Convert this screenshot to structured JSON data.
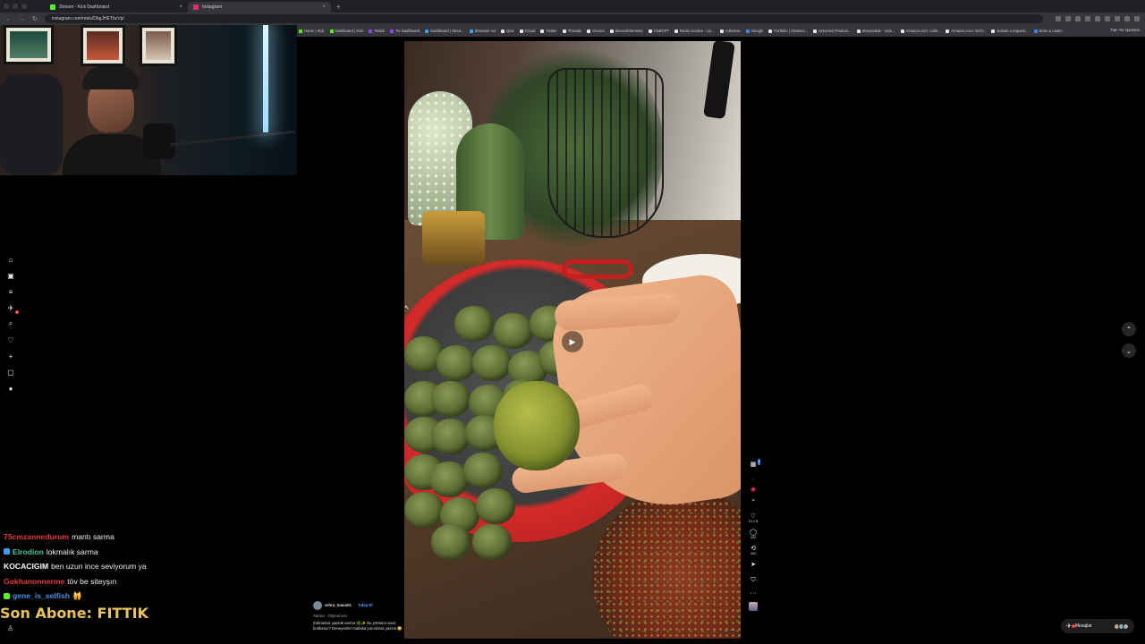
{
  "browser": {
    "tabs": [
      {
        "label": "Stream - Kick Dashboard",
        "color": "#53fc18",
        "active": false
      },
      {
        "label": "Instagram",
        "color": "#e1306c",
        "active": true
      }
    ],
    "url": "instagram.com/reels/DbgJHETbcVp/",
    "bookmarks": [
      "Home | Kick",
      "Dashboard | Kick",
      "Twitch",
      "Tw Dashboard",
      "Dashboard | Strea...",
      "Streamer Ad",
      "Qovi",
      "iCloud",
      "Twitter",
      "Threads",
      "Ozurus",
      "StreamElements",
      "ChatGPT",
      "Radio Garden - Lis...",
      "AdSense",
      "Google",
      "Portfolio | Shutters...",
      "Universal Product...",
      "Streamable - Vide...",
      "Amazon.com: USB...",
      "Amazon.com: NOV...",
      "Submit a request...",
      "Drive & Listen"
    ],
    "bookmarks_right": "Tüm Yer İşaretleri"
  },
  "chat": [
    {
      "user": "75cmzannedurum",
      "color": "#e53935",
      "badge": "",
      "message": "mantı sarma"
    },
    {
      "user": "Elrodion",
      "color": "#43c6a1",
      "badge": "#3aa0ff",
      "message": "lokmalık sarma"
    },
    {
      "user": "KOCACIGIM",
      "color": "#ffffff",
      "badge": "",
      "message": "ben uzun ince seviyorum ya"
    },
    {
      "user": "Gokhanonnerme",
      "color": "#e53935",
      "badge": "",
      "message": "töv be siteyşın"
    },
    {
      "user": "gene_is_selfish",
      "color": "#4a90e2",
      "badge": "#53fc18",
      "message": "🙀"
    }
  ],
  "sub_banner": "Son Abone: FITTIK",
  "post": {
    "username": "zehra_tuana01",
    "follow": "Takip Et",
    "audio": "Sarma · Orijinal ses",
    "caption": "Zahmetsiz yaprak sarma 🌿✨ Bu yöntemi nasıl buldunuz? Deneyenler mutlaka yorumlara yazsın 😋",
    "likes": "10,3 B",
    "comments": "444",
    "reposts": "363"
  },
  "messages": {
    "label": "Mesajlar",
    "badge": "1"
  }
}
